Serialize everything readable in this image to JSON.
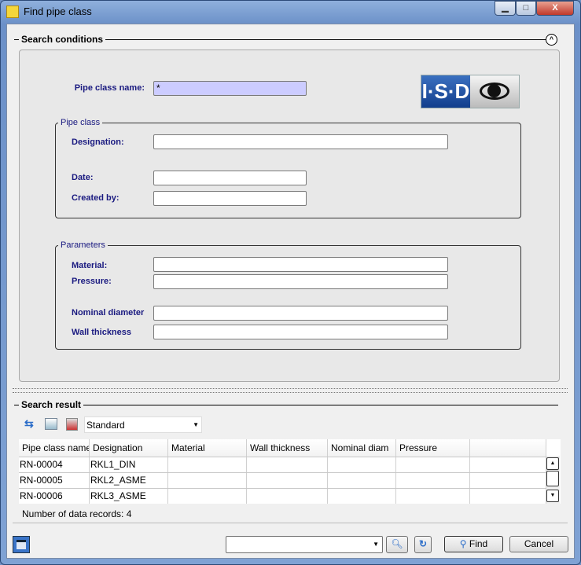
{
  "window": {
    "title": "Find pipe class",
    "icon": "app-icon"
  },
  "search_conditions": {
    "title": "Search conditions",
    "pipe_class_name_label": "Pipe class name:",
    "pipe_class_name_value": "*",
    "logo_text": "I·S·D",
    "pipe_class": {
      "legend": "Pipe class",
      "designation_label": "Designation:",
      "date_label": "Date:",
      "created_by_label": "Created by:"
    },
    "parameters": {
      "legend": "Parameters",
      "material_label": "Material:",
      "pressure_label": "Pressure:",
      "nominal_diameter_label": "Nominal diameter",
      "wall_thickness_label": "Wall thickness"
    }
  },
  "search_result": {
    "title": "Search result",
    "view_select": "Standard",
    "columns": [
      "Pipe class name",
      "Designation",
      "Material",
      "Wall thickness",
      "Nominal diam",
      "Pressure",
      ""
    ],
    "rows": [
      [
        "RN-00004",
        "RKL1_DIN"
      ],
      [
        "RN-00005",
        "RKL2_ASME"
      ],
      [
        "RN-00006",
        "RKL3_ASME"
      ]
    ],
    "records_text": "Number of data records: 4"
  },
  "footer": {
    "find_label": "Find",
    "cancel_label": "Cancel",
    "combo_value": ""
  },
  "colors": {
    "label": "#1a1a80",
    "highlight_input": "#ccccff",
    "title_bar": "#6b90c8"
  }
}
